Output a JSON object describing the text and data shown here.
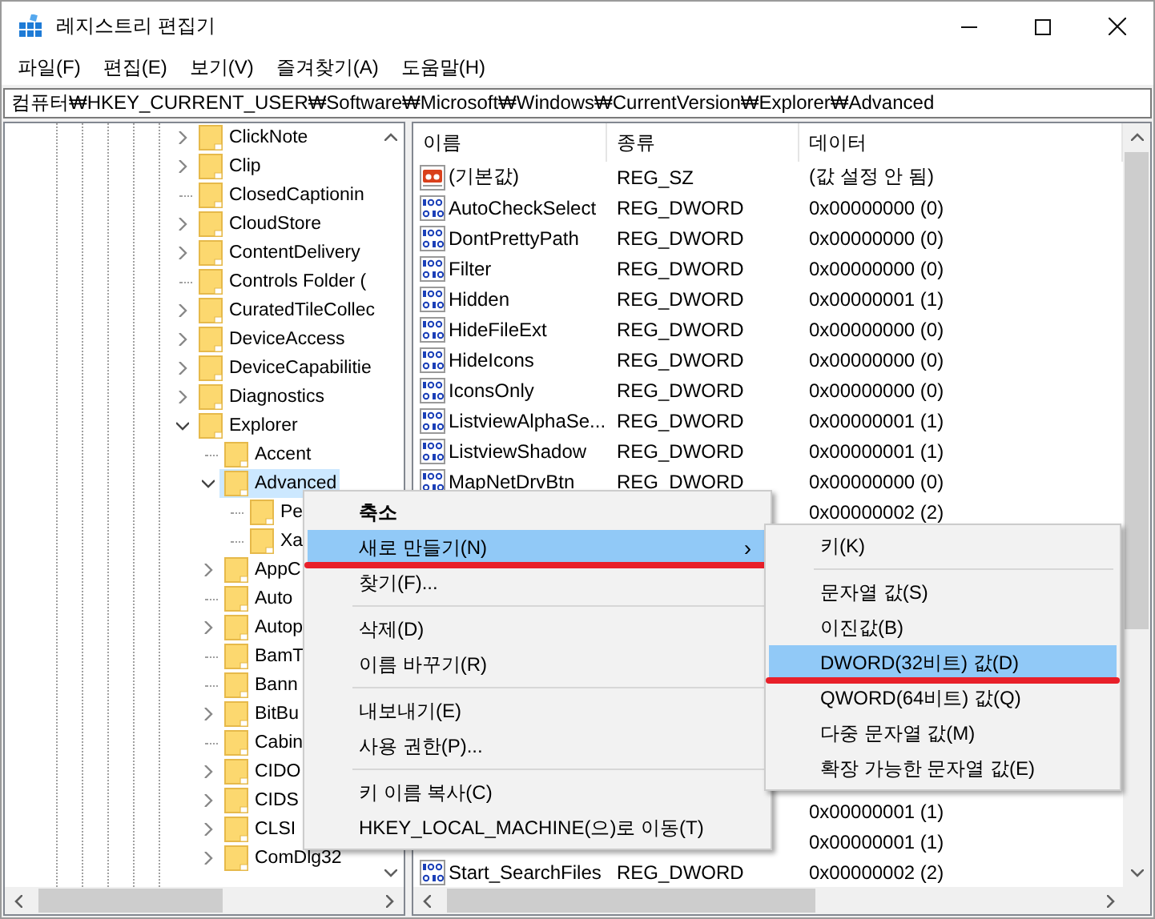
{
  "window": {
    "title": "레지스트리 편집기"
  },
  "menu_bar": [
    "파일(F)",
    "편집(E)",
    "보기(V)",
    "즐겨찾기(A)",
    "도움말(H)"
  ],
  "address": "컴퓨터₩HKEY_CURRENT_USER₩Software₩Microsoft₩Windows₩CurrentVersion₩Explorer₩Advanced",
  "tree": {
    "items": [
      {
        "label": "ClickNote",
        "expandable": true,
        "expanded": false,
        "selected": false
      },
      {
        "label": "Clip",
        "expandable": true,
        "expanded": false,
        "selected": false
      },
      {
        "label": "ClosedCaptionin",
        "expandable": false,
        "selected": false
      },
      {
        "label": "CloudStore",
        "expandable": true,
        "expanded": false,
        "selected": false
      },
      {
        "label": "ContentDelivery",
        "expandable": true,
        "expanded": false,
        "selected": false
      },
      {
        "label": "Controls Folder (",
        "expandable": false,
        "selected": false
      },
      {
        "label": "CuratedTileCollec",
        "expandable": true,
        "expanded": false,
        "selected": false
      },
      {
        "label": "DeviceAccess",
        "expandable": true,
        "expanded": false,
        "selected": false
      },
      {
        "label": "DeviceCapabilitie",
        "expandable": true,
        "expanded": false,
        "selected": false
      },
      {
        "label": "Diagnostics",
        "expandable": true,
        "expanded": false,
        "selected": false
      },
      {
        "label": "Explorer",
        "expandable": true,
        "expanded": true,
        "selected": false,
        "children": [
          {
            "label": "Accent",
            "expandable": false,
            "selected": false
          },
          {
            "label": "Advanced",
            "expandable": true,
            "expanded": true,
            "selected": true,
            "children": [
              {
                "label": "Pe",
                "expandable": false,
                "selected": false
              },
              {
                "label": "Xa",
                "expandable": false,
                "selected": false
              }
            ]
          },
          {
            "label": "AppC",
            "expandable": true,
            "expanded": false,
            "selected": false
          },
          {
            "label": "Auto",
            "expandable": false,
            "selected": false
          },
          {
            "label": "Autop",
            "expandable": true,
            "expanded": false,
            "selected": false
          },
          {
            "label": "BamT",
            "expandable": false,
            "selected": false
          },
          {
            "label": "Bann",
            "expandable": false,
            "selected": false
          },
          {
            "label": "BitBu",
            "expandable": true,
            "expanded": false,
            "selected": false
          },
          {
            "label": "Cabin",
            "expandable": false,
            "selected": false
          },
          {
            "label": "CIDO",
            "expandable": true,
            "expanded": false,
            "selected": false
          },
          {
            "label": "CIDS",
            "expandable": true,
            "expanded": false,
            "selected": false
          },
          {
            "label": "CLSI",
            "expandable": true,
            "expanded": false,
            "selected": false
          },
          {
            "label": "ComDlg32",
            "expandable": true,
            "expanded": false,
            "selected": false
          }
        ]
      }
    ]
  },
  "values": {
    "columns": [
      "이름",
      "종류",
      "데이터"
    ],
    "rows": [
      {
        "kind": "string",
        "name": "(기본값)",
        "type": "REG_SZ",
        "data": "(값 설정 안 됨)"
      },
      {
        "kind": "dword",
        "name": "AutoCheckSelect",
        "type": "REG_DWORD",
        "data": "0x00000000 (0)"
      },
      {
        "kind": "dword",
        "name": "DontPrettyPath",
        "type": "REG_DWORD",
        "data": "0x00000000 (0)"
      },
      {
        "kind": "dword",
        "name": "Filter",
        "type": "REG_DWORD",
        "data": "0x00000000 (0)"
      },
      {
        "kind": "dword",
        "name": "Hidden",
        "type": "REG_DWORD",
        "data": "0x00000001 (1)"
      },
      {
        "kind": "dword",
        "name": "HideFileExt",
        "type": "REG_DWORD",
        "data": "0x00000000 (0)"
      },
      {
        "kind": "dword",
        "name": "HideIcons",
        "type": "REG_DWORD",
        "data": "0x00000000 (0)"
      },
      {
        "kind": "dword",
        "name": "IconsOnly",
        "type": "REG_DWORD",
        "data": "0x00000000 (0)"
      },
      {
        "kind": "dword",
        "name": "ListviewAlphaSe...",
        "type": "REG_DWORD",
        "data": "0x00000001 (1)"
      },
      {
        "kind": "dword",
        "name": "ListviewShadow",
        "type": "REG_DWORD",
        "data": "0x00000001 (1)"
      },
      {
        "kind": "dword",
        "name": "MapNetDrvBtn",
        "type": "REG_DWORD",
        "data": "0x00000000 (0)"
      },
      {
        "data": "0x00000002 (2)"
      }
    ],
    "rows_below_menu": [
      {
        "data": "0x00000001 (1)"
      },
      {
        "data": "0x00000001 (1)"
      },
      {
        "kind": "dword",
        "name": "Start_SearchFiles",
        "type": "REG_DWORD",
        "data": "0x00000002 (2)"
      }
    ]
  },
  "context_menu": {
    "items": [
      {
        "kind": "item",
        "label": "축소",
        "default": true,
        "selected": false,
        "annotated": false
      },
      {
        "kind": "item",
        "label": "새로 만들기(N)",
        "arrow": "›",
        "selected": true,
        "annotated": true
      },
      {
        "kind": "item",
        "label": "찾기(F)...",
        "selected": false,
        "annotated": false
      },
      {
        "kind": "separator"
      },
      {
        "kind": "item",
        "label": "삭제(D)",
        "selected": false,
        "annotated": false
      },
      {
        "kind": "item",
        "label": "이름 바꾸기(R)",
        "selected": false,
        "annotated": false
      },
      {
        "kind": "separator"
      },
      {
        "kind": "item",
        "label": "내보내기(E)",
        "selected": false,
        "annotated": false
      },
      {
        "kind": "item",
        "label": "사용 권한(P)...",
        "selected": false,
        "annotated": false
      },
      {
        "kind": "separator"
      },
      {
        "kind": "item",
        "label": "키 이름 복사(C)",
        "selected": false,
        "annotated": false
      },
      {
        "kind": "item",
        "label": "HKEY_LOCAL_MACHINE(으)로 이동(T)",
        "selected": false,
        "annotated": false
      }
    ]
  },
  "submenu": {
    "items": [
      {
        "kind": "item",
        "label": "키(K)",
        "selected": false,
        "annotated": false
      },
      {
        "kind": "separator"
      },
      {
        "kind": "item",
        "label": "문자열 값(S)",
        "selected": false,
        "annotated": false
      },
      {
        "kind": "item",
        "label": "이진값(B)",
        "selected": false,
        "annotated": false
      },
      {
        "kind": "item",
        "label": "DWORD(32비트) 값(D)",
        "selected": true,
        "annotated": true
      },
      {
        "kind": "item",
        "label": "QWORD(64비트) 값(Q)",
        "selected": false,
        "annotated": false
      },
      {
        "kind": "item",
        "label": "다중 문자열 값(M)",
        "selected": false,
        "annotated": false
      },
      {
        "kind": "item",
        "label": "확장 가능한 문자열 값(E)",
        "selected": false,
        "annotated": false
      }
    ]
  }
}
